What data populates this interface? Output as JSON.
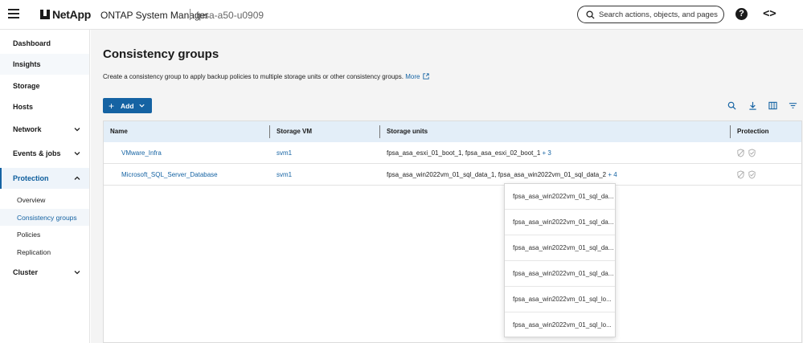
{
  "header": {
    "brand": "NetApp",
    "app_title": "ONTAP System Manager",
    "cluster": "fpsa-a50-u0909",
    "search_placeholder": "Search actions, objects, and pages",
    "help_glyph": "?",
    "code_glyph": "<>"
  },
  "sidebar": {
    "items": [
      {
        "label": "Dashboard"
      },
      {
        "label": "Insights"
      },
      {
        "label": "Storage"
      },
      {
        "label": "Hosts"
      },
      {
        "label": "Network"
      },
      {
        "label": "Events & jobs"
      },
      {
        "label": "Protection"
      },
      {
        "label": "Cluster"
      }
    ],
    "protection_sub": [
      {
        "label": "Overview"
      },
      {
        "label": "Consistency groups"
      },
      {
        "label": "Policies"
      },
      {
        "label": "Replication"
      }
    ]
  },
  "main": {
    "title": "Consistency groups",
    "description": "Create a consistency group to apply backup policies to multiple storage units or other consistency groups.",
    "more_link": "More",
    "add_button": "Add",
    "add_glyph": "+"
  },
  "table": {
    "columns": [
      "Name",
      "Storage VM",
      "Storage units",
      "Protection"
    ],
    "rows": [
      {
        "name": "VMware_Infra",
        "svm": "svm1",
        "units": "fpsa_asa_esxi_01_boot_1, fpsa_asa_esxi_02_boot_1",
        "more": "+ 3"
      },
      {
        "name": "Microsoft_SQL_Server_Database",
        "svm": "svm1",
        "units": "fpsa_asa_win2022vm_01_sql_data_1, fpsa_asa_win2022vm_01_sql_data_2",
        "more": "+ 4"
      }
    ]
  },
  "popup": {
    "items": [
      "fpsa_asa_win2022vm_01_sql_da...",
      "fpsa_asa_win2022vm_01_sql_da...",
      "fpsa_asa_win2022vm_01_sql_da...",
      "fpsa_asa_win2022vm_01_sql_da...",
      "fpsa_asa_win2022vm_01_sql_lo...",
      "fpsa_asa_win2022vm_01_sql_lo..."
    ]
  },
  "colors": {
    "accent": "#1563a3",
    "header_row": "#e3eef8",
    "content_bg": "#f4f4f4"
  }
}
